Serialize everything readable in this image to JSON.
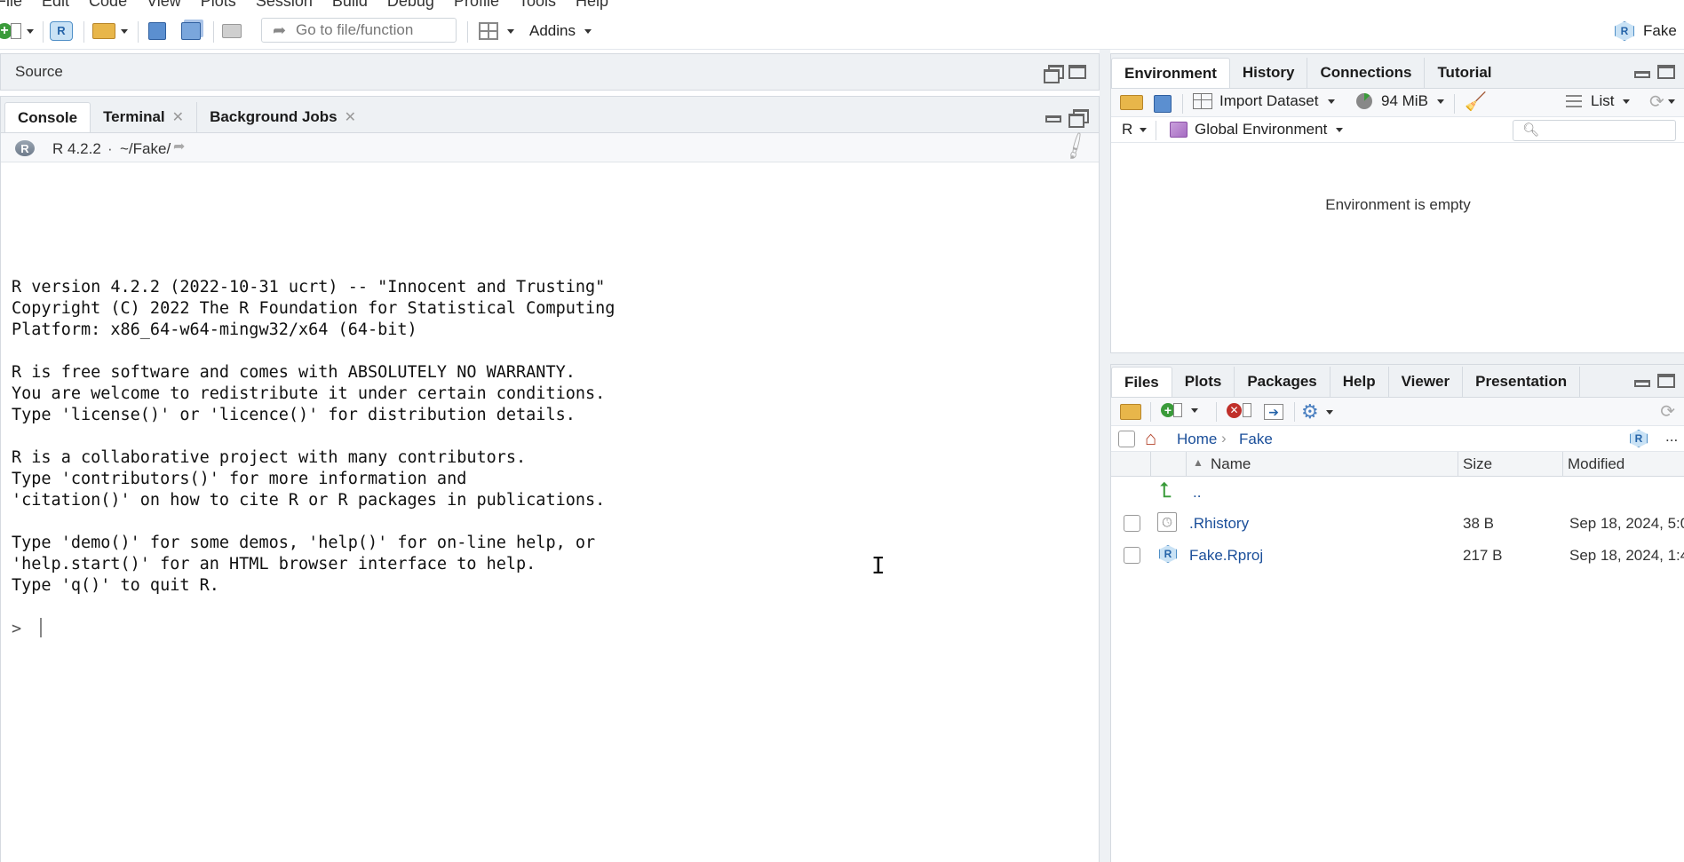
{
  "menu": [
    "File",
    "Edit",
    "Code",
    "View",
    "Plots",
    "Session",
    "Build",
    "Debug",
    "Profile",
    "Tools",
    "Help"
  ],
  "toolbar": {
    "goto_placeholder": "Go to file/function",
    "addins_label": "Addins",
    "project_label": "Fake"
  },
  "source_pane": {
    "title": "Source"
  },
  "console_pane": {
    "tabs": [
      {
        "label": "Console",
        "active": true,
        "closable": false
      },
      {
        "label": "Terminal",
        "active": false,
        "closable": true
      },
      {
        "label": "Background Jobs",
        "active": false,
        "closable": true
      }
    ],
    "r_version": "R 4.2.2",
    "separator": "·",
    "working_dir": "~/Fake/",
    "output": "R version 4.2.2 (2022-10-31 ucrt) -- \"Innocent and Trusting\"\nCopyright (C) 2022 The R Foundation for Statistical Computing\nPlatform: x86_64-w64-mingw32/x64 (64-bit)\n\nR is free software and comes with ABSOLUTELY NO WARRANTY.\nYou are welcome to redistribute it under certain conditions.\nType 'license()' or 'licence()' for distribution details.\n\nR is a collaborative project with many contributors.\nType 'contributors()' for more information and\n'citation()' on how to cite R or R packages in publications.\n\nType 'demo()' for some demos, 'help()' for on-line help, or\n'help.start()' for an HTML browser interface to help.\nType 'q()' to quit R.",
    "prompt": ">"
  },
  "env_pane": {
    "tabs": [
      {
        "label": "Environment",
        "active": true
      },
      {
        "label": "History",
        "active": false
      },
      {
        "label": "Connections",
        "active": false
      },
      {
        "label": "Tutorial",
        "active": false
      }
    ],
    "import_label": "Import Dataset",
    "memory_label": "94 MiB",
    "view_label": "List",
    "language_label": "R",
    "scope_label": "Global Environment",
    "search_placeholder": "",
    "empty_message": "Environment is empty"
  },
  "files_pane": {
    "tabs": [
      {
        "label": "Files",
        "active": true
      },
      {
        "label": "Plots",
        "active": false
      },
      {
        "label": "Packages",
        "active": false
      },
      {
        "label": "Help",
        "active": false
      },
      {
        "label": "Viewer",
        "active": false
      },
      {
        "label": "Presentation",
        "active": false
      }
    ],
    "breadcrumb": [
      "Home",
      "Fake"
    ],
    "more_label": "...",
    "columns": [
      "Name",
      "Size",
      "Modified"
    ],
    "parent_label": "..",
    "files": [
      {
        "name": ".Rhistory",
        "size": "38 B",
        "modified": "Sep 18, 2024, 5:0",
        "icon": "history-file-icon"
      },
      {
        "name": "Fake.Rproj",
        "size": "217 B",
        "modified": "Sep 18, 2024, 1:4",
        "icon": "rproj-file-icon"
      }
    ]
  },
  "colors": {
    "pane_bg": "#eef1f4",
    "link": "#1b4f9a",
    "accent_green": "#3a9b3a"
  }
}
